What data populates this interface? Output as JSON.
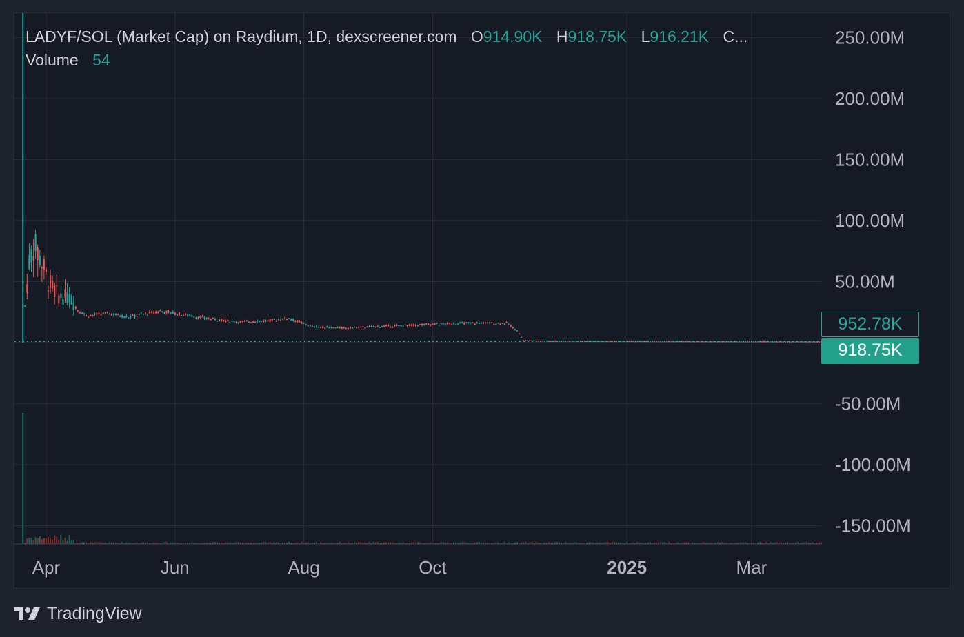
{
  "legend": {
    "title": "LADYF/SOL (Market Cap) on Raydium, 1D, dexscreener.com",
    "o_label": "O",
    "o_value": "914.90K",
    "h_label": "H",
    "h_value": "918.75K",
    "l_label": "L",
    "l_value": "916.21K",
    "c_label": "C...",
    "volume_label": "Volume",
    "volume_value": "54"
  },
  "price_tags": {
    "previous": "952.78K",
    "last": "918.75K"
  },
  "footer": {
    "brand": "TradingView"
  },
  "colors": {
    "up": "#26a69a",
    "down": "#ef5350",
    "grid": "#2a2e39",
    "axis_text": "#b2b5be",
    "background": "#161a25"
  },
  "chart_data": {
    "type": "candlestick",
    "symbol": "LADYF/SOL (Market Cap)",
    "interval": "1D",
    "y_axis": {
      "unit": "USD market cap",
      "ylim": [
        -165000000,
        270000000
      ],
      "ticks": [
        250000000,
        200000000,
        150000000,
        100000000,
        50000000,
        0,
        -50000000,
        -100000000,
        -150000000
      ],
      "tick_labels": [
        "250.00M",
        "200.00M",
        "150.00M",
        "100.00M",
        "50.00M",
        "",
        "-50.00M",
        "-100.00M",
        "-150.00M"
      ]
    },
    "x_axis": {
      "start": "2024-03-17",
      "end": "2025-04-03",
      "ticks": [
        "2024-04-01",
        "2024-06-01",
        "2024-08-01",
        "2024-10-01",
        "2025-01-01",
        "2025-03-01"
      ],
      "tick_labels": [
        "Apr",
        "Jun",
        "Aug",
        "Oct",
        "2025",
        "Mar"
      ],
      "bold_labels": [
        "2025"
      ]
    },
    "grid": true,
    "last_price": 918750,
    "previous_price": 952780,
    "spike": {
      "date": "2024-03-21",
      "high": 295000000,
      "volume_relative": 1.0
    },
    "series_anchors": [
      {
        "date": "2024-03-22",
        "value": 30000000
      },
      {
        "date": "2024-03-24",
        "value": 65000000
      },
      {
        "date": "2024-03-26",
        "value": 80000000
      },
      {
        "date": "2024-03-29",
        "value": 70000000
      },
      {
        "date": "2024-04-02",
        "value": 50000000
      },
      {
        "date": "2024-04-07",
        "value": 38000000
      },
      {
        "date": "2024-04-12",
        "value": 37000000
      },
      {
        "date": "2024-04-16",
        "value": 27000000
      },
      {
        "date": "2024-04-20",
        "value": 22000000
      },
      {
        "date": "2024-04-30",
        "value": 24000000
      },
      {
        "date": "2024-05-10",
        "value": 21000000
      },
      {
        "date": "2024-05-25",
        "value": 26000000
      },
      {
        "date": "2024-06-01",
        "value": 24000000
      },
      {
        "date": "2024-06-15",
        "value": 20000000
      },
      {
        "date": "2024-07-01",
        "value": 17000000
      },
      {
        "date": "2024-07-15",
        "value": 18000000
      },
      {
        "date": "2024-07-25",
        "value": 20000000
      },
      {
        "date": "2024-08-05",
        "value": 13000000
      },
      {
        "date": "2024-08-20",
        "value": 12000000
      },
      {
        "date": "2024-09-10",
        "value": 13500000
      },
      {
        "date": "2024-09-30",
        "value": 15000000
      },
      {
        "date": "2024-10-20",
        "value": 16000000
      },
      {
        "date": "2024-11-05",
        "value": 16000000
      },
      {
        "date": "2024-11-10",
        "value": 10000000
      },
      {
        "date": "2024-11-13",
        "value": 2000000
      },
      {
        "date": "2024-11-25",
        "value": 1500000
      },
      {
        "date": "2025-01-15",
        "value": 1200000
      },
      {
        "date": "2025-04-03",
        "value": 918750
      }
    ]
  }
}
